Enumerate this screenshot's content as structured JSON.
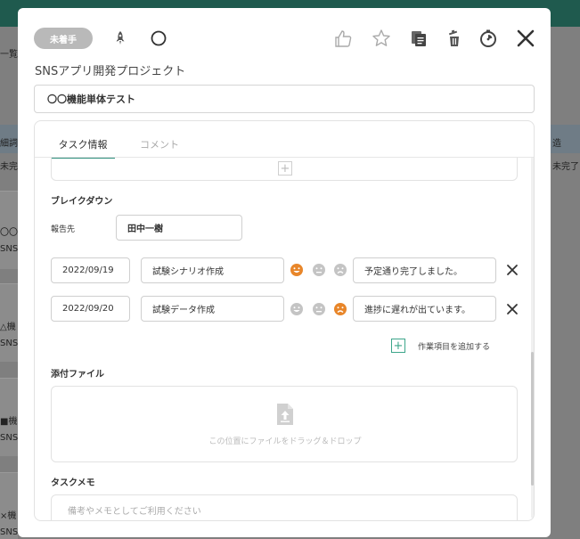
{
  "background": {
    "left_texts": [
      "一覧",
      "細詞",
      "未完了",
      "〇〇機",
      "SNSア",
      "△機",
      "SNSア",
      "■機",
      "SNSア",
      "×機",
      "SNSア"
    ],
    "right_texts": [
      "造",
      "未完了"
    ]
  },
  "modal": {
    "status": "未着手",
    "icons": {
      "rocket": "rocket-icon",
      "circle": "circle-icon",
      "like": "thumbs-up-icon",
      "star": "star-icon",
      "copy": "copy-icon",
      "delete": "trash-icon",
      "timer": "stopwatch-icon",
      "close": "close-icon"
    },
    "project_name": "SNSアプリ開発プロジェクト",
    "task_title": "〇〇機能単体テスト",
    "tabs": [
      {
        "label": "タスク情報",
        "active": true
      },
      {
        "label": "コメント",
        "active": false
      }
    ],
    "breakdown": {
      "heading": "ブレイクダウン",
      "report_to_label": "報告先",
      "report_to_value": "田中一樹",
      "rows": [
        {
          "date": "2022/09/19",
          "task": "試験シナリオ作成",
          "mood": "happy",
          "note": "予定通り完了しました。"
        },
        {
          "date": "2022/09/20",
          "task": "試験データ作成",
          "mood": "sad",
          "note": "進捗に遅れが出ています。"
        }
      ],
      "add_item_label": "作業項目を追加する"
    },
    "attachments": {
      "heading": "添付ファイル",
      "drop_text": "この位置にファイルをドラッグ＆ドロップ"
    },
    "memo": {
      "heading": "タスクメモ",
      "placeholder": "備考やメモとしてご利用ください"
    },
    "colors": {
      "accent": "#2f8f7d",
      "mood_active": "#e8862a",
      "mood_inactive": "#c4c4c4",
      "status_badge": "#b9b9b9"
    }
  }
}
